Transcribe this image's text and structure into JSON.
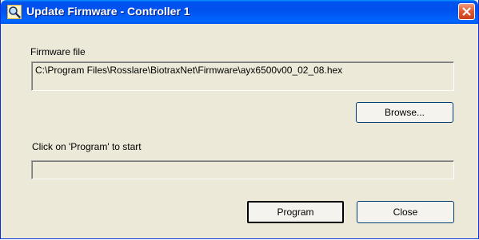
{
  "window": {
    "title": "Update Firmware - Controller 1",
    "title_icon": "magnifier-icon",
    "close_icon": "close-icon"
  },
  "firmware": {
    "label": "Firmware file",
    "path": "C:\\Program Files\\Rosslare\\BiotraxNet\\Firmware\\ayx6500v00_02_08.hex"
  },
  "buttons": {
    "browse_label": "Browse...",
    "program_label": "Program",
    "close_label": "Close"
  },
  "status": {
    "text": "Click on 'Program' to start",
    "progress": 0
  },
  "colors": {
    "titlebar": "#0054e3",
    "close_button": "#e0572e",
    "dialog_bg": "#ece9d8"
  }
}
